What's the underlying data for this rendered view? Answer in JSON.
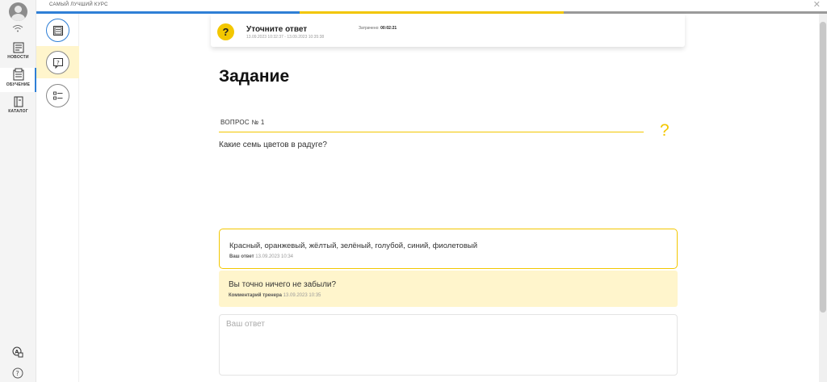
{
  "topbar": {
    "course_title": "САМЫЙ ЛУЧШИЙ КУРС",
    "close_symbol": "✕"
  },
  "progress_colors": [
    "#2f7fd6",
    "#f3c700",
    "#9a9a9a"
  ],
  "sidebar": {
    "items": [
      {
        "label": "НОВОСТИ",
        "icon": "news-icon"
      },
      {
        "label": "ОБУЧЕНИЕ",
        "icon": "learning-icon",
        "active": true
      },
      {
        "label": "КАТАЛОГ",
        "icon": "catalog-icon"
      }
    ],
    "bottom_icons": [
      "translate-icon",
      "help-icon"
    ]
  },
  "step_panel": {
    "buttons": [
      "lesson-book-icon",
      "question-icon",
      "checklist-icon"
    ],
    "active_index": 1
  },
  "status": {
    "icon_symbol": "?",
    "title": "Уточните ответ",
    "dates": "13.09.2023 10:32:37 - 13.09.2023 10:35:38",
    "spent_label": "Затрачено:",
    "spent_value": "00:02:21"
  },
  "task": {
    "heading": "Задание",
    "question_label": "ВОПРОС № 1",
    "hint_symbol": "?",
    "question_text": "Какие семь цветов в радуге?"
  },
  "answer": {
    "text": "Красный, оранжевый, жёлтый, зелёный, голубой, синий, фиолетовый",
    "meta_label": "Ваш ответ",
    "meta_date": "13.09.2023 10:34"
  },
  "comment": {
    "text": "Вы точно ничего не забыли?",
    "meta_label": "Комментарий тренера",
    "meta_date": "13.09.2023 10:35"
  },
  "input": {
    "placeholder": "Ваш ответ",
    "value": ""
  },
  "colors": {
    "accent_blue": "#2f7fd6",
    "accent_yellow": "#f3c700",
    "highlight_bg": "#fff5cc"
  }
}
